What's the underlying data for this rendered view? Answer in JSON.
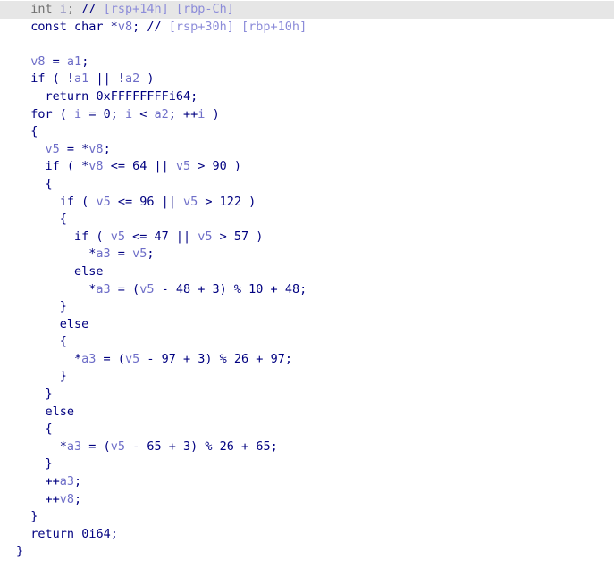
{
  "view": {
    "name": "hex-rays-pseudocode",
    "background_color": "#ffffff",
    "default_text_color": "#000080",
    "variable_color": "#6E6EC8",
    "stack_offset_color": "#8C8CD9",
    "highlight_row_color": "#e6e6e6",
    "dim_text_color": "#707070"
  },
  "code": {
    "language": "c-pseudocode",
    "lines": [
      {
        "index": 0,
        "highlighted": true,
        "text": "  int i; // [rsp+14h] [rbp-Ch]",
        "tokens": [
          {
            "text": "  ",
            "cls": "t-punc"
          },
          {
            "text": "int",
            "cls": "t-dim"
          },
          {
            "text": " ",
            "cls": "t-punc"
          },
          {
            "text": "i",
            "cls": "t-dimvar"
          },
          {
            "text": ";",
            "cls": "t-dim"
          },
          {
            "text": " ",
            "cls": "t-punc"
          },
          {
            "text": "//",
            "cls": "t-comment"
          },
          {
            "text": " ",
            "cls": "t-punc"
          },
          {
            "text": "[rsp+14h] [rbp-Ch]",
            "cls": "t-stkoff"
          }
        ]
      },
      {
        "index": 1,
        "highlighted": false,
        "text": "  const char *v8; // [rsp+30h] [rbp+10h]",
        "tokens": [
          {
            "text": "  ",
            "cls": "t-punc"
          },
          {
            "text": "const char",
            "cls": "t-type"
          },
          {
            "text": " *",
            "cls": "t-op"
          },
          {
            "text": "v8",
            "cls": "t-var"
          },
          {
            "text": ";",
            "cls": "t-punc"
          },
          {
            "text": " ",
            "cls": "t-punc"
          },
          {
            "text": "//",
            "cls": "t-comment"
          },
          {
            "text": " ",
            "cls": "t-punc"
          },
          {
            "text": "[rsp+30h] [rbp+10h]",
            "cls": "t-stkoff"
          }
        ]
      },
      {
        "index": 2,
        "highlighted": false,
        "text": "",
        "tokens": []
      },
      {
        "index": 3,
        "highlighted": false,
        "text": "  v8 = a1;",
        "tokens": [
          {
            "text": "  ",
            "cls": "t-punc"
          },
          {
            "text": "v8",
            "cls": "t-var"
          },
          {
            "text": " = ",
            "cls": "t-op"
          },
          {
            "text": "a1",
            "cls": "t-arg"
          },
          {
            "text": ";",
            "cls": "t-punc"
          }
        ]
      },
      {
        "index": 4,
        "highlighted": false,
        "text": "  if ( !a1 || !a2 )",
        "tokens": [
          {
            "text": "  ",
            "cls": "t-punc"
          },
          {
            "text": "if",
            "cls": "t-kw"
          },
          {
            "text": " ( !",
            "cls": "t-punc"
          },
          {
            "text": "a1",
            "cls": "t-arg"
          },
          {
            "text": " || !",
            "cls": "t-op"
          },
          {
            "text": "a2",
            "cls": "t-arg"
          },
          {
            "text": " )",
            "cls": "t-punc"
          }
        ]
      },
      {
        "index": 5,
        "highlighted": false,
        "text": "    return 0xFFFFFFFFi64;",
        "tokens": [
          {
            "text": "    ",
            "cls": "t-punc"
          },
          {
            "text": "return",
            "cls": "t-kw"
          },
          {
            "text": " ",
            "cls": "t-punc"
          },
          {
            "text": "0xFFFFFFFFi64",
            "cls": "t-num"
          },
          {
            "text": ";",
            "cls": "t-punc"
          }
        ]
      },
      {
        "index": 6,
        "highlighted": false,
        "text": "  for ( i = 0; i < a2; ++i )",
        "tokens": [
          {
            "text": "  ",
            "cls": "t-punc"
          },
          {
            "text": "for",
            "cls": "t-kw"
          },
          {
            "text": " ( ",
            "cls": "t-punc"
          },
          {
            "text": "i",
            "cls": "t-var"
          },
          {
            "text": " = ",
            "cls": "t-op"
          },
          {
            "text": "0",
            "cls": "t-num"
          },
          {
            "text": "; ",
            "cls": "t-punc"
          },
          {
            "text": "i",
            "cls": "t-var"
          },
          {
            "text": " < ",
            "cls": "t-op"
          },
          {
            "text": "a2",
            "cls": "t-arg"
          },
          {
            "text": "; ++",
            "cls": "t-op"
          },
          {
            "text": "i",
            "cls": "t-var"
          },
          {
            "text": " )",
            "cls": "t-punc"
          }
        ]
      },
      {
        "index": 7,
        "highlighted": false,
        "text": "  {",
        "tokens": [
          {
            "text": "  {",
            "cls": "t-punc"
          }
        ]
      },
      {
        "index": 8,
        "highlighted": false,
        "text": "    v5 = *v8;",
        "tokens": [
          {
            "text": "    ",
            "cls": "t-punc"
          },
          {
            "text": "v5",
            "cls": "t-var"
          },
          {
            "text": " = *",
            "cls": "t-op"
          },
          {
            "text": "v8",
            "cls": "t-var"
          },
          {
            "text": ";",
            "cls": "t-punc"
          }
        ]
      },
      {
        "index": 9,
        "highlighted": false,
        "text": "    if ( *v8 <= 64 || v5 > 90 )",
        "tokens": [
          {
            "text": "    ",
            "cls": "t-punc"
          },
          {
            "text": "if",
            "cls": "t-kw"
          },
          {
            "text": " ( *",
            "cls": "t-punc"
          },
          {
            "text": "v8",
            "cls": "t-var"
          },
          {
            "text": " <= ",
            "cls": "t-op"
          },
          {
            "text": "64",
            "cls": "t-num"
          },
          {
            "text": " || ",
            "cls": "t-op"
          },
          {
            "text": "v5",
            "cls": "t-var"
          },
          {
            "text": " > ",
            "cls": "t-op"
          },
          {
            "text": "90",
            "cls": "t-num"
          },
          {
            "text": " )",
            "cls": "t-punc"
          }
        ]
      },
      {
        "index": 10,
        "highlighted": false,
        "text": "    {",
        "tokens": [
          {
            "text": "    {",
            "cls": "t-punc"
          }
        ]
      },
      {
        "index": 11,
        "highlighted": false,
        "text": "      if ( v5 <= 96 || v5 > 122 )",
        "tokens": [
          {
            "text": "      ",
            "cls": "t-punc"
          },
          {
            "text": "if",
            "cls": "t-kw"
          },
          {
            "text": " ( ",
            "cls": "t-punc"
          },
          {
            "text": "v5",
            "cls": "t-var"
          },
          {
            "text": " <= ",
            "cls": "t-op"
          },
          {
            "text": "96",
            "cls": "t-num"
          },
          {
            "text": " || ",
            "cls": "t-op"
          },
          {
            "text": "v5",
            "cls": "t-var"
          },
          {
            "text": " > ",
            "cls": "t-op"
          },
          {
            "text": "122",
            "cls": "t-num"
          },
          {
            "text": " )",
            "cls": "t-punc"
          }
        ]
      },
      {
        "index": 12,
        "highlighted": false,
        "text": "      {",
        "tokens": [
          {
            "text": "      {",
            "cls": "t-punc"
          }
        ]
      },
      {
        "index": 13,
        "highlighted": false,
        "text": "        if ( v5 <= 47 || v5 > 57 )",
        "tokens": [
          {
            "text": "        ",
            "cls": "t-punc"
          },
          {
            "text": "if",
            "cls": "t-kw"
          },
          {
            "text": " ( ",
            "cls": "t-punc"
          },
          {
            "text": "v5",
            "cls": "t-var"
          },
          {
            "text": " <= ",
            "cls": "t-op"
          },
          {
            "text": "47",
            "cls": "t-num"
          },
          {
            "text": " || ",
            "cls": "t-op"
          },
          {
            "text": "v5",
            "cls": "t-var"
          },
          {
            "text": " > ",
            "cls": "t-op"
          },
          {
            "text": "57",
            "cls": "t-num"
          },
          {
            "text": " )",
            "cls": "t-punc"
          }
        ]
      },
      {
        "index": 14,
        "highlighted": false,
        "text": "          *a3 = v5;",
        "tokens": [
          {
            "text": "          *",
            "cls": "t-op"
          },
          {
            "text": "a3",
            "cls": "t-arg"
          },
          {
            "text": " = ",
            "cls": "t-op"
          },
          {
            "text": "v5",
            "cls": "t-var"
          },
          {
            "text": ";",
            "cls": "t-punc"
          }
        ]
      },
      {
        "index": 15,
        "highlighted": false,
        "text": "        else",
        "tokens": [
          {
            "text": "        ",
            "cls": "t-punc"
          },
          {
            "text": "else",
            "cls": "t-kw"
          }
        ]
      },
      {
        "index": 16,
        "highlighted": false,
        "text": "          *a3 = (v5 - 48 + 3) % 10 + 48;",
        "tokens": [
          {
            "text": "          *",
            "cls": "t-op"
          },
          {
            "text": "a3",
            "cls": "t-arg"
          },
          {
            "text": " = (",
            "cls": "t-op"
          },
          {
            "text": "v5",
            "cls": "t-var"
          },
          {
            "text": " - ",
            "cls": "t-op"
          },
          {
            "text": "48",
            "cls": "t-num"
          },
          {
            "text": " + ",
            "cls": "t-op"
          },
          {
            "text": "3",
            "cls": "t-num"
          },
          {
            "text": ") % ",
            "cls": "t-op"
          },
          {
            "text": "10",
            "cls": "t-num"
          },
          {
            "text": " + ",
            "cls": "t-op"
          },
          {
            "text": "48",
            "cls": "t-num"
          },
          {
            "text": ";",
            "cls": "t-punc"
          }
        ]
      },
      {
        "index": 17,
        "highlighted": false,
        "text": "      }",
        "tokens": [
          {
            "text": "      }",
            "cls": "t-punc"
          }
        ]
      },
      {
        "index": 18,
        "highlighted": false,
        "text": "      else",
        "tokens": [
          {
            "text": "      ",
            "cls": "t-punc"
          },
          {
            "text": "else",
            "cls": "t-kw"
          }
        ]
      },
      {
        "index": 19,
        "highlighted": false,
        "text": "      {",
        "tokens": [
          {
            "text": "      {",
            "cls": "t-punc"
          }
        ]
      },
      {
        "index": 20,
        "highlighted": false,
        "text": "        *a3 = (v5 - 97 + 3) % 26 + 97;",
        "tokens": [
          {
            "text": "        *",
            "cls": "t-op"
          },
          {
            "text": "a3",
            "cls": "t-arg"
          },
          {
            "text": " = (",
            "cls": "t-op"
          },
          {
            "text": "v5",
            "cls": "t-var"
          },
          {
            "text": " - ",
            "cls": "t-op"
          },
          {
            "text": "97",
            "cls": "t-num"
          },
          {
            "text": " + ",
            "cls": "t-op"
          },
          {
            "text": "3",
            "cls": "t-num"
          },
          {
            "text": ") % ",
            "cls": "t-op"
          },
          {
            "text": "26",
            "cls": "t-num"
          },
          {
            "text": " + ",
            "cls": "t-op"
          },
          {
            "text": "97",
            "cls": "t-num"
          },
          {
            "text": ";",
            "cls": "t-punc"
          }
        ]
      },
      {
        "index": 21,
        "highlighted": false,
        "text": "      }",
        "tokens": [
          {
            "text": "      }",
            "cls": "t-punc"
          }
        ]
      },
      {
        "index": 22,
        "highlighted": false,
        "text": "    }",
        "tokens": [
          {
            "text": "    }",
            "cls": "t-punc"
          }
        ]
      },
      {
        "index": 23,
        "highlighted": false,
        "text": "    else",
        "tokens": [
          {
            "text": "    ",
            "cls": "t-punc"
          },
          {
            "text": "else",
            "cls": "t-kw"
          }
        ]
      },
      {
        "index": 24,
        "highlighted": false,
        "text": "    {",
        "tokens": [
          {
            "text": "    {",
            "cls": "t-punc"
          }
        ]
      },
      {
        "index": 25,
        "highlighted": false,
        "text": "      *a3 = (v5 - 65 + 3) % 26 + 65;",
        "tokens": [
          {
            "text": "      *",
            "cls": "t-op"
          },
          {
            "text": "a3",
            "cls": "t-arg"
          },
          {
            "text": " = (",
            "cls": "t-op"
          },
          {
            "text": "v5",
            "cls": "t-var"
          },
          {
            "text": " - ",
            "cls": "t-op"
          },
          {
            "text": "65",
            "cls": "t-num"
          },
          {
            "text": " + ",
            "cls": "t-op"
          },
          {
            "text": "3",
            "cls": "t-num"
          },
          {
            "text": ") % ",
            "cls": "t-op"
          },
          {
            "text": "26",
            "cls": "t-num"
          },
          {
            "text": " + ",
            "cls": "t-op"
          },
          {
            "text": "65",
            "cls": "t-num"
          },
          {
            "text": ";",
            "cls": "t-punc"
          }
        ]
      },
      {
        "index": 26,
        "highlighted": false,
        "text": "    }",
        "tokens": [
          {
            "text": "    }",
            "cls": "t-punc"
          }
        ]
      },
      {
        "index": 27,
        "highlighted": false,
        "text": "    ++a3;",
        "tokens": [
          {
            "text": "    ++",
            "cls": "t-op"
          },
          {
            "text": "a3",
            "cls": "t-arg"
          },
          {
            "text": ";",
            "cls": "t-punc"
          }
        ]
      },
      {
        "index": 28,
        "highlighted": false,
        "text": "    ++v8;",
        "tokens": [
          {
            "text": "    ++",
            "cls": "t-op"
          },
          {
            "text": "v8",
            "cls": "t-var"
          },
          {
            "text": ";",
            "cls": "t-punc"
          }
        ]
      },
      {
        "index": 29,
        "highlighted": false,
        "text": "  }",
        "tokens": [
          {
            "text": "  }",
            "cls": "t-punc"
          }
        ]
      },
      {
        "index": 30,
        "highlighted": false,
        "text": "  return 0i64;",
        "tokens": [
          {
            "text": "  ",
            "cls": "t-punc"
          },
          {
            "text": "return",
            "cls": "t-kw"
          },
          {
            "text": " ",
            "cls": "t-punc"
          },
          {
            "text": "0i64",
            "cls": "t-num"
          },
          {
            "text": ";",
            "cls": "t-punc"
          }
        ]
      },
      {
        "index": 31,
        "highlighted": false,
        "text": "}",
        "tokens": [
          {
            "text": "}",
            "cls": "t-punc"
          }
        ]
      }
    ]
  }
}
